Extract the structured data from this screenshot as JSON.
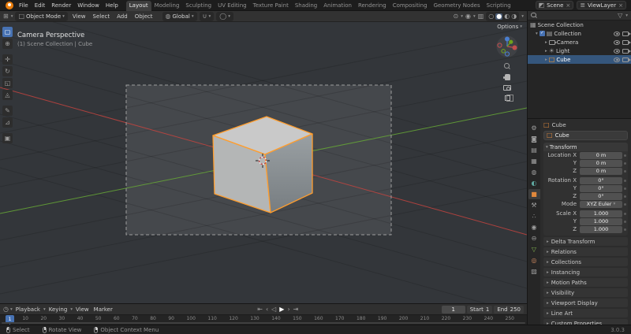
{
  "topbar": {
    "menus": [
      "File",
      "Edit",
      "Render",
      "Window",
      "Help"
    ],
    "tabs": [
      "Layout",
      "Modeling",
      "Sculpting",
      "UV Editing",
      "Texture Paint",
      "Shading",
      "Animation",
      "Rendering",
      "Compositing",
      "Geometry Nodes",
      "Scripting"
    ],
    "scene_field": "Scene",
    "view_layer_field": "ViewLayer"
  },
  "viewport_header": {
    "mode": "Object Mode",
    "menus": [
      "View",
      "Select",
      "Add",
      "Object"
    ],
    "orientation": "Global",
    "options_label": "Options"
  },
  "viewport": {
    "view_label": "Camera Perspective",
    "context_label": "(1) Scene Collection | Cube"
  },
  "outliner": {
    "root": "Scene Collection",
    "collection": "Collection",
    "items": [
      "Camera",
      "Light",
      "Cube"
    ]
  },
  "properties": {
    "breadcrumb": "Cube",
    "name_value": "Cube",
    "transform_title": "Transform",
    "fields": [
      {
        "label": "Location X",
        "value": "0 m"
      },
      {
        "label": "Y",
        "value": "0 m"
      },
      {
        "label": "Z",
        "value": "0 m"
      },
      {
        "label": "Rotation X",
        "value": "0°"
      },
      {
        "label": "Y",
        "value": "0°"
      },
      {
        "label": "Z",
        "value": "0°"
      },
      {
        "label": "Mode",
        "value": "XYZ Euler"
      },
      {
        "label": "Scale X",
        "value": "1.000"
      },
      {
        "label": "Y",
        "value": "1.000"
      },
      {
        "label": "Z",
        "value": "1.000"
      }
    ],
    "sections": [
      "Delta Transform",
      "Relations",
      "Collections",
      "Instancing",
      "Motion Paths",
      "Visibility",
      "Viewport Display",
      "Line Art",
      "Custom Properties"
    ]
  },
  "timeline": {
    "menus": [
      "Playback",
      "Keying",
      "View",
      "Marker"
    ],
    "current_frame": "1",
    "start_label": "Start",
    "start_value": "1",
    "end_label": "End",
    "end_value": "250",
    "ticks": [
      "1",
      "10",
      "20",
      "30",
      "40",
      "50",
      "60",
      "70",
      "80",
      "90",
      "100",
      "110",
      "120",
      "130",
      "140",
      "150",
      "160",
      "170",
      "180",
      "190",
      "200",
      "210",
      "220",
      "230",
      "240",
      "250"
    ]
  },
  "statusbar": {
    "hints": [
      "Select",
      "Rotate View",
      "Object Context Menu"
    ],
    "version": "3.0.3"
  },
  "colors": {
    "accent_blue": "#4772b3",
    "selection_orange": "#ff9d2d",
    "axis_x_red": "#c4443f",
    "axis_y_green": "#67a836"
  },
  "icons": {
    "caret_down": "▾",
    "caret_right": "▸",
    "close": "×",
    "check": "✓",
    "select_box_tool": "▢",
    "cursor_tool": "⊕",
    "move_tool": "✛",
    "rotate_tool": "↻",
    "scale_tool": "◱",
    "transform_tool": "◬",
    "annotate_tool": "✎",
    "measure_tool": "⊿",
    "add_cube_tool": "▣",
    "editor_viewport": "⊞",
    "editor_timeline": "◷",
    "object_mode": "□",
    "orientation_globe": "◍",
    "snap_magnet": "∪",
    "proportional": "◯",
    "pivot": "⊙",
    "overlays": "◉",
    "xray": "▥",
    "shading_wireframe": "○",
    "shading_solid": "●",
    "shading_material": "◐",
    "shading_rendered": "◑",
    "scene": "◩",
    "view_layer": "≣",
    "filter": "▽",
    "scene_collection": "▦",
    "collection": "▤",
    "light": "☀",
    "mesh_cube": "□",
    "mesh_triangle": "△",
    "tab_tool": "⚙",
    "tab_render": "◙",
    "tab_output": "▤",
    "tab_view_layer": "▦",
    "tab_scene": "◍",
    "tab_world": "◐",
    "tab_object": "■",
    "tab_modifiers": "⚒",
    "tab_particles": "∴",
    "tab_physics": "◉",
    "tab_constraints": "⊖",
    "tab_data": "▽",
    "tab_material": "◎",
    "tab_texture": "▨",
    "jump_start": "⇤",
    "prev_keyframe": "‹",
    "play_reverse": "◁",
    "play": "▶",
    "next_keyframe": "›",
    "jump_end": "⇥"
  }
}
